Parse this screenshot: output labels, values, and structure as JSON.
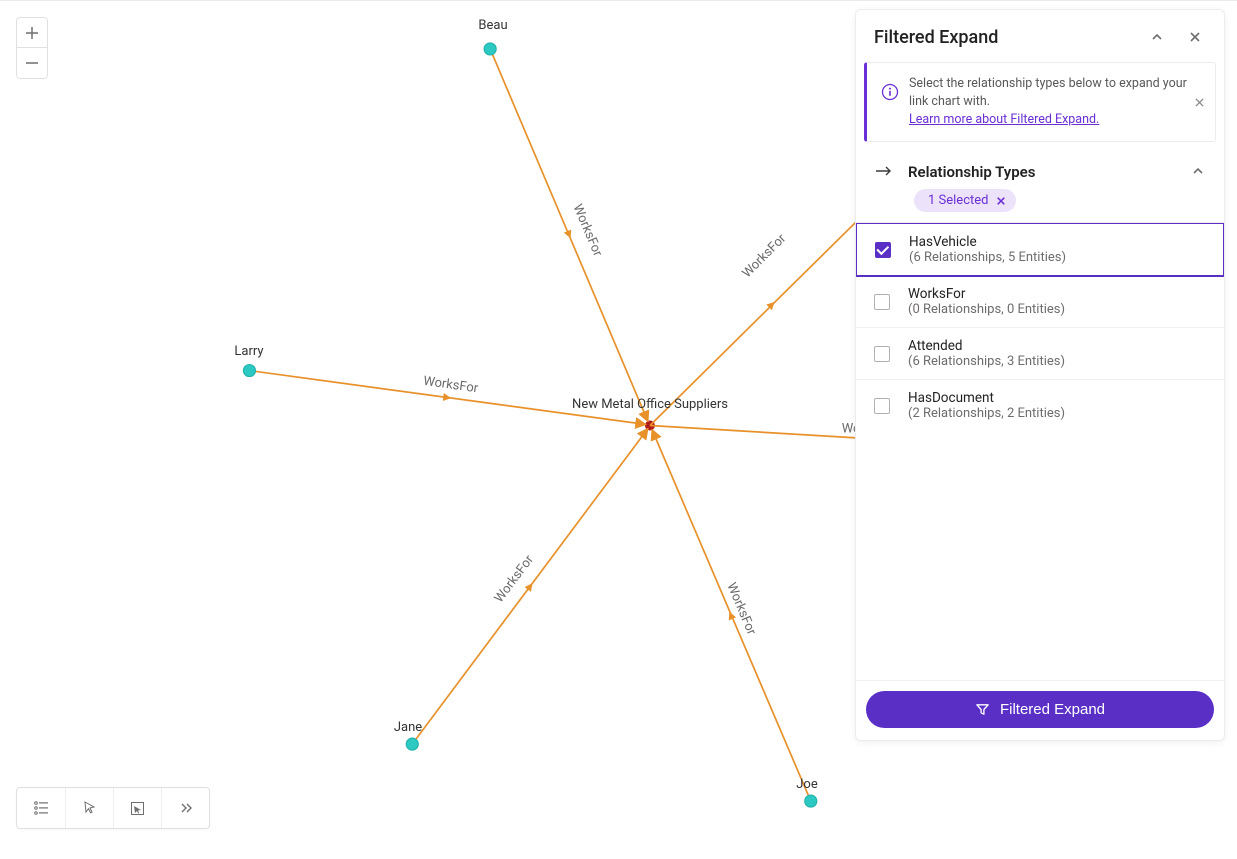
{
  "graph": {
    "center_label": "New Metal Office Suppliers",
    "nodes": {
      "beau": "Beau",
      "larry": "Larry",
      "jane": "Jane",
      "joe": "Joe"
    },
    "edge_label": "WorksFor"
  },
  "panel": {
    "title": "Filtered Expand",
    "info": {
      "text": "Select the relationship types below to expand your link chart with.",
      "link_label": "Learn more about Filtered Expand."
    },
    "section": {
      "title": "Relationship Types",
      "selected_pill": "1 Selected"
    },
    "relationships": [
      {
        "name": "HasVehicle",
        "detail": "(6 Relationships, 5 Entities)",
        "selected": true
      },
      {
        "name": "WorksFor",
        "detail": "(0 Relationships, 0 Entities)",
        "selected": false
      },
      {
        "name": "Attended",
        "detail": "(6 Relationships, 3 Entities)",
        "selected": false
      },
      {
        "name": "HasDocument",
        "detail": "(2 Relationships, 2 Entities)",
        "selected": false
      }
    ],
    "action_button": "Filtered Expand"
  }
}
